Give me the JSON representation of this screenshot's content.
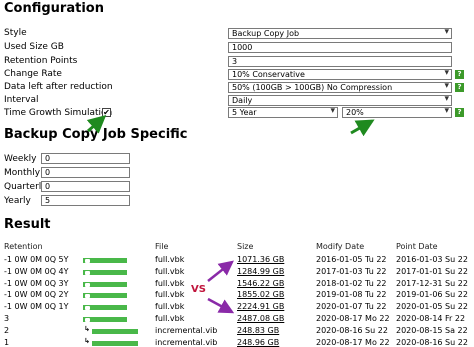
{
  "configuration": {
    "heading": "Configuration",
    "style": {
      "label": "Style",
      "value": "Backup Copy Job"
    },
    "used_size": {
      "label": "Used Size GB",
      "value": "1000"
    },
    "retention_points": {
      "label": "Retention Points",
      "value": "3"
    },
    "change_rate": {
      "label": "Change Rate",
      "value": "10% Conservative"
    },
    "data_left": {
      "label": "Data left after reduction",
      "value": "50% (100GB > 100GB) No Compression"
    },
    "interval": {
      "label": "Interval",
      "value": "Daily"
    },
    "time_growth": {
      "label": "Time Growth Simulation",
      "checkbox": "✔",
      "years": "5 Year",
      "percent": "20%"
    },
    "help_glyph": "?"
  },
  "copy_job": {
    "heading": "Backup Copy Job Specific",
    "weekly": {
      "label": "Weekly",
      "value": "0"
    },
    "monthly": {
      "label": "Monthly",
      "value": "0"
    },
    "quarterly": {
      "label": "Quarterly",
      "value": "0"
    },
    "yearly": {
      "label": "Yearly",
      "value": "5"
    }
  },
  "result": {
    "heading": "Result",
    "columns": {
      "retention": "Retention",
      "file": "File",
      "size": "Size",
      "modify_date": "Modify Date",
      "point_date": "Point Date"
    },
    "rows": [
      {
        "retention": "-1 0W 0M 0Q 5Y",
        "file": "full.vbk",
        "size": "1071.36 GB",
        "modify": "2016-01-05 Tu 22",
        "point": "2016-01-03 Su 22",
        "kind": "full",
        "fill": 0.8
      },
      {
        "retention": "-1 0W 0M 0Q 4Y",
        "file": "full.vbk",
        "size": "1284.99 GB",
        "modify": "2017-01-03 Tu 22",
        "point": "2017-01-01 Su 22",
        "kind": "full",
        "fill": 0.8
      },
      {
        "retention": "-1 0W 0M 0Q 3Y",
        "file": "full.vbk",
        "size": "1546.22 GB",
        "modify": "2018-01-02 Tu 22",
        "point": "2017-12-31 Su 22",
        "kind": "full",
        "fill": 0.8
      },
      {
        "retention": "-1 0W 0M 0Q 2Y",
        "file": "full.vbk",
        "size": "1855.02 GB",
        "modify": "2019-01-08 Tu 22",
        "point": "2019-01-06 Su 22",
        "kind": "full",
        "fill": 0.8
      },
      {
        "retention": "-1 0W 0M 0Q 1Y",
        "file": "full.vbk",
        "size": "2224.91 GB",
        "modify": "2020-01-07 Tu 22",
        "point": "2020-01-05 Su 22",
        "kind": "full",
        "fill": 0.8
      },
      {
        "retention": "3",
        "file": "full.vbk",
        "size": "2487.08 GB",
        "modify": "2020-08-17 Mo 22",
        "point": "2020-08-14 Fr 22",
        "kind": "full",
        "fill": 0.8
      },
      {
        "retention": "2",
        "file": "incremental.vib",
        "size": "248.83 GB",
        "modify": "2020-08-16 Su 22",
        "point": "2020-08-15 Sa 22",
        "kind": "inc",
        "fill": 1
      },
      {
        "retention": "1",
        "file": "incremental.vib",
        "size": "248.96 GB",
        "modify": "2020-08-17 Mo 22",
        "point": "2020-08-16 Su 22",
        "kind": "inc",
        "fill": 1
      }
    ],
    "vs_label": "VS"
  },
  "colors": {
    "accent_green": "#3c9a2a",
    "bar_green": "#49b849",
    "annotation_purple": "#8a2aa8",
    "annotation_red": "#c0143c"
  }
}
